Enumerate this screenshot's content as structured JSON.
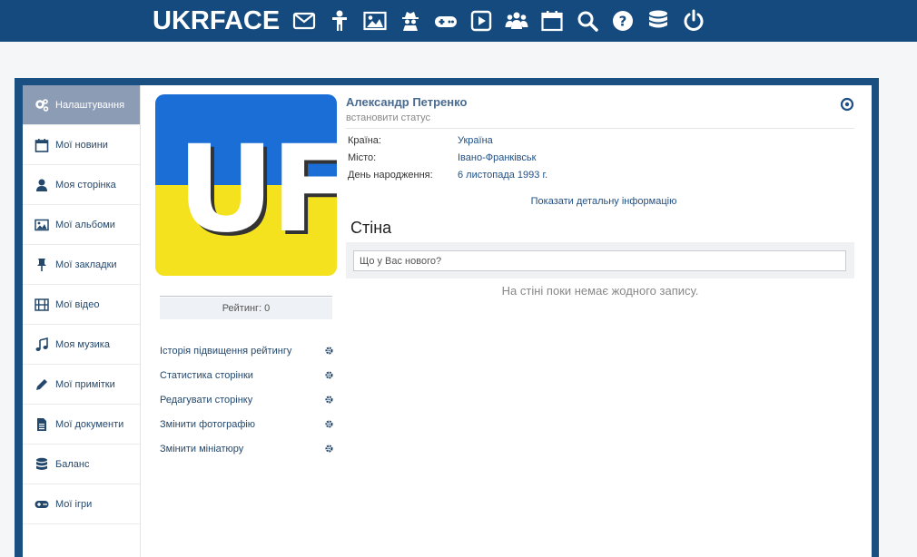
{
  "header": {
    "logo": "UKRFACE",
    "icons": [
      "mail-icon",
      "person-icon",
      "image-icon",
      "spy-icon",
      "gamepad-icon",
      "play-icon",
      "users-icon",
      "calendar-icon",
      "search-icon",
      "help-icon",
      "database-icon",
      "power-icon"
    ]
  },
  "sidebar": {
    "items": [
      {
        "label": "Налаштування",
        "icon": "gears-icon"
      },
      {
        "label": "Мої новини",
        "icon": "calendar-icon"
      },
      {
        "label": "Моя сторінка",
        "icon": "user-icon"
      },
      {
        "label": "Мої альбоми",
        "icon": "image-icon"
      },
      {
        "label": "Мої закладки",
        "icon": "pin-icon"
      },
      {
        "label": "Мої відео",
        "icon": "film-icon"
      },
      {
        "label": "Моя музика",
        "icon": "music-icon"
      },
      {
        "label": "Мої примітки",
        "icon": "pencil-icon"
      },
      {
        "label": "Мої документи",
        "icon": "document-icon"
      },
      {
        "label": "Баланс",
        "icon": "database-icon"
      },
      {
        "label": "Мої ігри",
        "icon": "gamepad-icon"
      }
    ]
  },
  "profile": {
    "avatar_text": "UF",
    "name": "Александр Петренко",
    "status": "встановити статус",
    "fields": [
      {
        "key": "Країна:",
        "value": "Україна"
      },
      {
        "key": "Місто:",
        "value": "Івано-Франківськ"
      },
      {
        "key": "День народження:",
        "value": "6 листопада 1993 г."
      }
    ],
    "detail_link": "Показати детальну інформацію",
    "rating": "Рейтинг: 0",
    "actions": [
      "Історія підвищення рейтингу",
      "Статистика сторінки",
      "Редагувати сторінку",
      "Змінити фотографію",
      "Змінити мініатюру"
    ]
  },
  "wall": {
    "title": "Стіна",
    "placeholder": "Що у Вас нового?",
    "empty": "На стіні поки немає жодного запису."
  },
  "colors": {
    "topbar": "#144a7e",
    "link": "#1f4f86",
    "sidebar_active": "#8d9cb5",
    "flag_blue": "#1a6ed6",
    "flag_yellow": "#f5e21e"
  }
}
